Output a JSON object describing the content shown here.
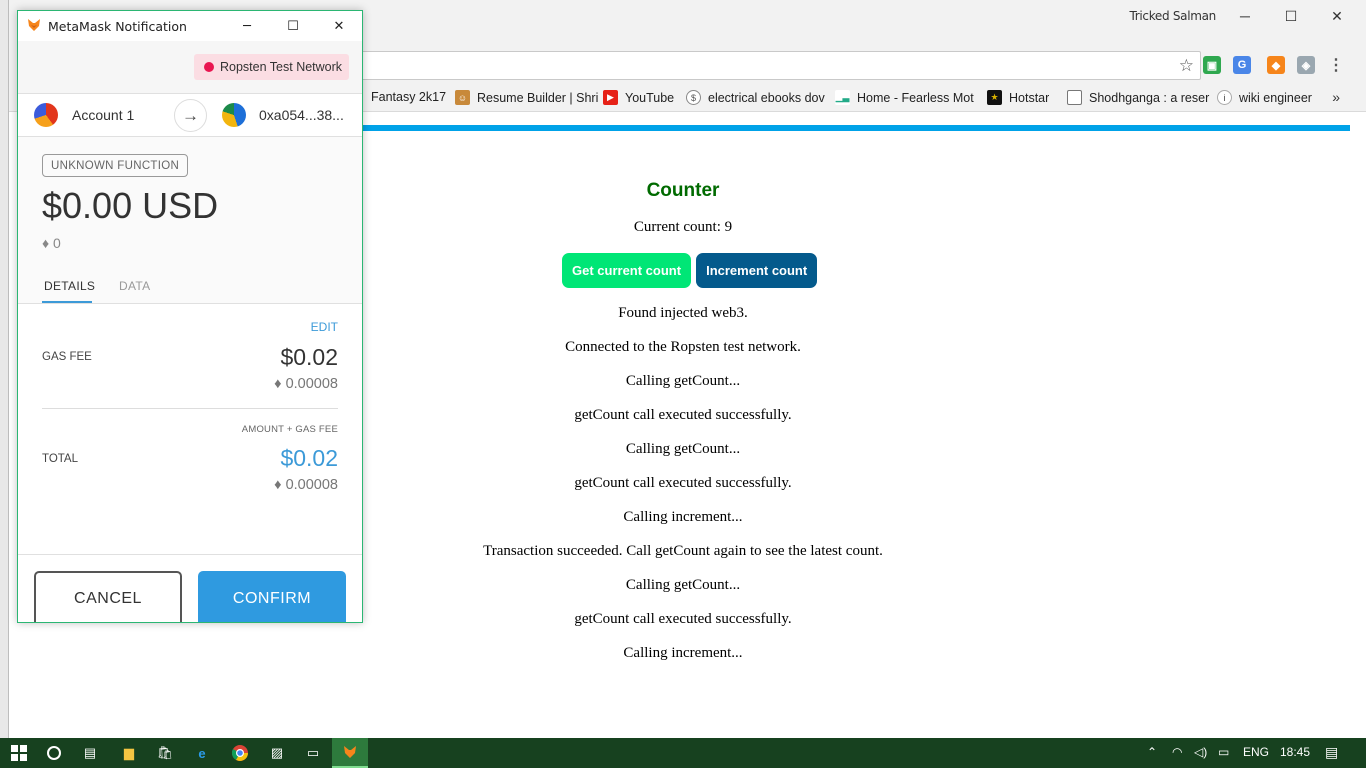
{
  "browser": {
    "user_name": "Tricked Salman",
    "window_controls": {
      "minimize": "─",
      "maximize": "☐",
      "close": "✕"
    },
    "bookmarks": [
      {
        "label": "Fantasy 2k17",
        "icon": "blank-icon"
      },
      {
        "label": "Resume Builder | Shri",
        "icon": "person-icon"
      },
      {
        "label": "YouTube",
        "icon": "youtube-icon"
      },
      {
        "label": "electrical ebooks dov",
        "icon": "dollar-icon"
      },
      {
        "label": "Home - Fearless Mot",
        "icon": "chart-icon"
      },
      {
        "label": "Hotstar",
        "icon": "star-icon"
      },
      {
        "label": "Shodhganga : a reser",
        "icon": "page-icon"
      },
      {
        "label": "wiki engineer",
        "icon": "wiki-icon"
      }
    ],
    "bookmarks_more": "»"
  },
  "page": {
    "title": "Counter",
    "current_count_label": "Current count: 9",
    "buttons": {
      "get_count": "Get current count",
      "increment": "Increment count"
    },
    "log": [
      "Found injected web3.",
      "Connected to the Ropsten test network.",
      "Calling getCount...",
      "getCount call executed successfully.",
      "Calling getCount...",
      "getCount call executed successfully.",
      "Calling increment...",
      "Transaction succeeded. Call getCount again to see the latest count.",
      "Calling getCount...",
      "getCount call executed successfully.",
      "Calling increment..."
    ]
  },
  "metamask": {
    "window_title": "MetaMask Notification",
    "network": "Ropsten Test Network",
    "network_color": "#e91550",
    "from_account": "Account 1",
    "to_address": "0xa054...38...",
    "function_badge": "UNKNOWN FUNCTION",
    "total_usd": "$0.00 USD",
    "eth_amount": "♦ 0",
    "tabs": {
      "details": "DETAILS",
      "data": "DATA"
    },
    "edit_label": "EDIT",
    "gas_fee_label": "GAS FEE",
    "gas_fee_usd": "$0.02",
    "gas_fee_eth": "♦ 0.00008",
    "amount_gas_label": "AMOUNT + GAS FEE",
    "total_label": "TOTAL",
    "total_fee_usd": "$0.02",
    "total_fee_eth": "♦ 0.00008",
    "cancel_label": "CANCEL",
    "confirm_label": "CONFIRM",
    "accent_color": "#2f9ae0"
  },
  "taskbar": {
    "language": "ENG",
    "time": "18:45"
  }
}
